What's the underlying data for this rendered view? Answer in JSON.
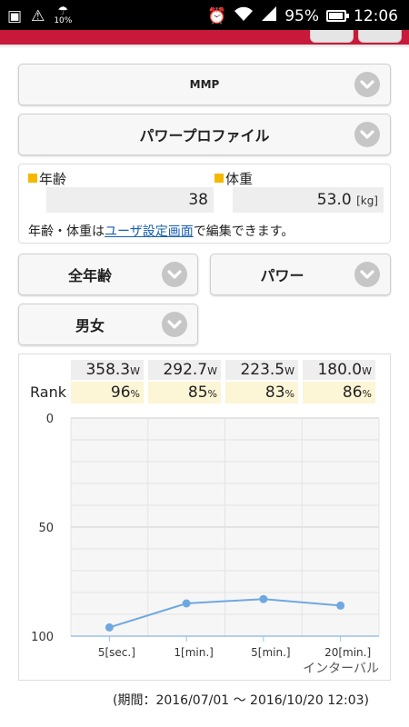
{
  "status_bar": {
    "weather": "10%",
    "battery": "95%",
    "battery_level": 0.95,
    "time": "12:06"
  },
  "dropdowns": {
    "metric": "MMP",
    "profile": "パワープロファイル",
    "age": "全年齢",
    "type": "パワー",
    "gender": "男女"
  },
  "profile": {
    "age_label": "年齢",
    "age_value": "38",
    "weight_label": "体重",
    "weight_value": "53.0",
    "weight_unit": "[kg]",
    "note_prefix": "年齢・体重は",
    "note_link": "ユーザ設定画面",
    "note_suffix": "で編集できます。"
  },
  "summary": {
    "rank_label": "Rank",
    "power_unit": "W",
    "rank_unit": "%",
    "power": [
      "358.3",
      "292.7",
      "223.5",
      "180.0"
    ],
    "rank": [
      "96",
      "85",
      "83",
      "86"
    ]
  },
  "chart_data": {
    "type": "line",
    "categories": [
      "5[sec.]",
      "1[min.]",
      "5[min.]",
      "20[min.]"
    ],
    "series": [
      {
        "values": [
          96,
          85,
          83,
          86
        ]
      }
    ],
    "xlabel": "インターバル",
    "ylabel": "",
    "ylim": [
      0,
      100
    ],
    "y_inverted": true,
    "yticks": [
      "0",
      "50",
      "100"
    ],
    "grid": true,
    "color": "#6fa8e0"
  },
  "period": "(期間：2016/07/01 ～ 2016/10/20 12:03)",
  "colors": {
    "accent": "#c8193a",
    "marker": "#f5b800",
    "line": "#6fa8e0"
  }
}
